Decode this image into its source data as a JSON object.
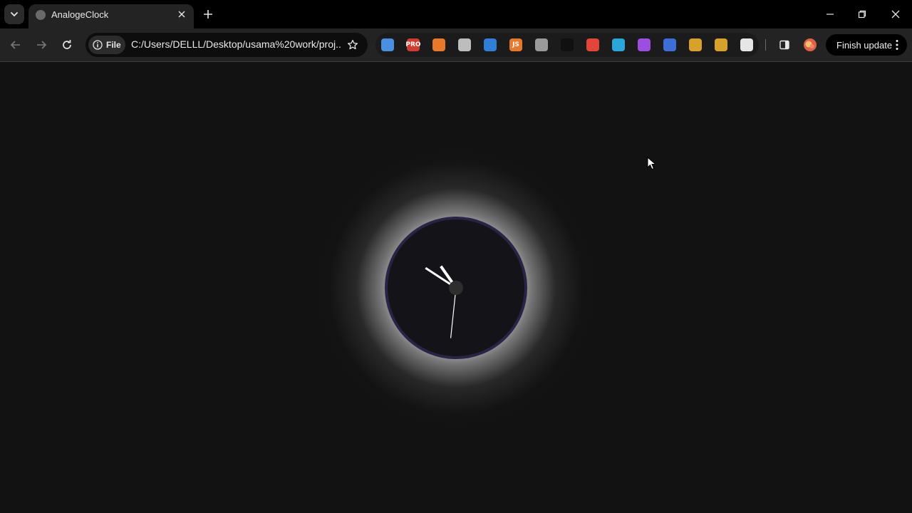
{
  "browser": {
    "tab": {
      "title": "AnalogeClock"
    },
    "address": {
      "site_chip_label": "File",
      "url": "C:/Users/DELLL/Desktop/usama%20work/proj..."
    },
    "update_button": {
      "label": "Finish update"
    },
    "extensions": [
      {
        "name": "ext-map-icon",
        "color": "#4a8fe0"
      },
      {
        "name": "ext-pro-icon",
        "color": "#d23b2f",
        "text": "PRO"
      },
      {
        "name": "ext-orange-icon",
        "color": "#e8792b"
      },
      {
        "name": "ext-cloud-icon",
        "color": "#bdbdbd"
      },
      {
        "name": "ext-blue-diamond-icon",
        "color": "#2f7fd8"
      },
      {
        "name": "ext-js-icon",
        "color": "#e8792b",
        "text": "JS"
      },
      {
        "name": "ext-fullscreen-icon",
        "color": "#9a9a9a"
      },
      {
        "name": "ext-dark-square-icon",
        "color": "#101010"
      },
      {
        "name": "ext-fire-icon",
        "color": "#e2463a"
      },
      {
        "name": "ext-shield-icon",
        "color": "#2aa7d8"
      },
      {
        "name": "ext-color-wheel-icon",
        "color": "#9b4ee0"
      },
      {
        "name": "ext-cube-icon",
        "color": "#3c6fd6"
      },
      {
        "name": "ext-wand-icon",
        "color": "#d8a12a"
      },
      {
        "name": "ext-download-icon",
        "color": "#d8a12a"
      },
      {
        "name": "extensions-puzzle-icon",
        "color": "#e6e6e6"
      }
    ]
  },
  "clock": {
    "face_color": "#141318",
    "rim_color": "#2a2347",
    "hand_color": "#ffffff",
    "center_color": "#2e2e2e",
    "time": {
      "hour": 10,
      "minute": 50,
      "second": 31
    }
  }
}
